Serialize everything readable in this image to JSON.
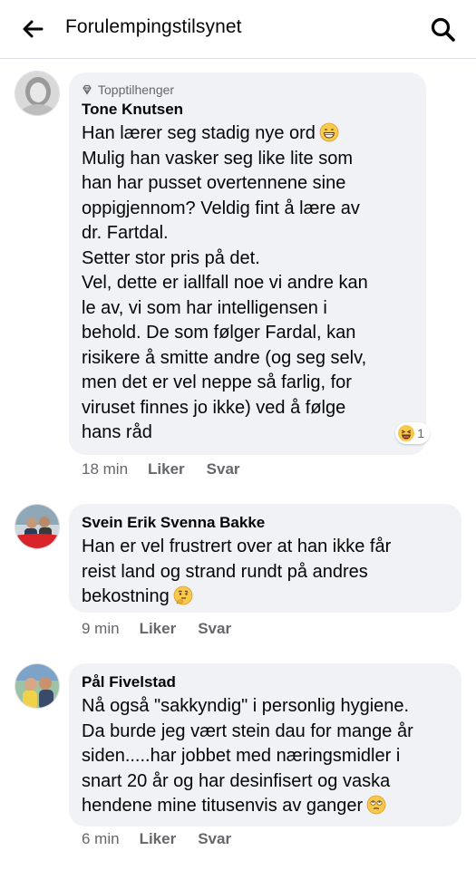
{
  "header": {
    "title": "Forulempingstilsynet",
    "back_icon": "arrow-left-icon",
    "search_icon": "search-icon"
  },
  "comments": [
    {
      "badge": "Topptilhenger",
      "author": "Tone Knutsen",
      "lines": [
        "Han lærer seg stadig nye ord",
        "Mulig han vasker seg like lite som",
        "han har pusset overtennene sine",
        "oppigjennom? Veldig fint å lære av",
        "dr. Fartdal.",
        "Setter stor pris på det.",
        "Vel, dette er iallfall noe vi andre kan",
        "le av, vi som har intelligensen i",
        "behold. De som følger Fardal, kan",
        "risikere å smitte andre (og seg selv,",
        "men det er vel neppe så farlig, for",
        "viruset finnes jo ikke) ved å følge",
        "hans råd"
      ],
      "reaction_count": "1",
      "time": "18 min",
      "like": "Liker",
      "reply": "Svar"
    },
    {
      "author": "Svein Erik Svenna Bakke",
      "lines": [
        "Han er vel frustrert over at han ikke får",
        "reist land og strand rundt på andres",
        "bekostning"
      ],
      "time": "9 min",
      "like": "Liker",
      "reply": "Svar"
    },
    {
      "author": "Pål Fivelstad",
      "lines": [
        "Nå også \"sakkyndig\" i personlig hygiene.",
        "Da burde jeg vært stein dau for mange år",
        "siden.....har jobbet med næringsmidler i",
        "snart 20 år og har desinfisert og vaska",
        "hendene mine titusenvis av ganger"
      ],
      "time": "6 min",
      "like": "Liker",
      "reply": "Svar"
    }
  ]
}
